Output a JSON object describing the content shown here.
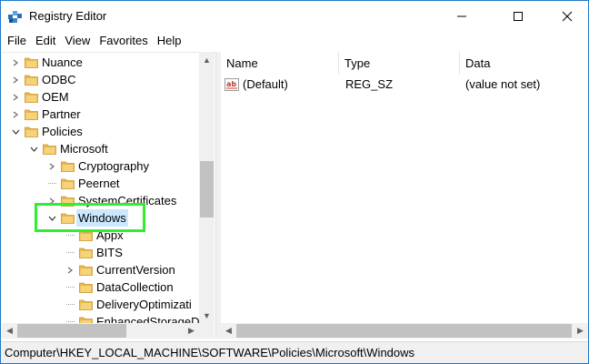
{
  "window": {
    "title": "Registry Editor",
    "icon": "registry-editor-icon"
  },
  "menu": [
    "File",
    "Edit",
    "View",
    "Favorites",
    "Help"
  ],
  "tree": {
    "items": [
      {
        "label": "Nuance",
        "expander": ">",
        "level": 0
      },
      {
        "label": "ODBC",
        "expander": ">",
        "level": 0
      },
      {
        "label": "OEM",
        "expander": ">",
        "level": 0
      },
      {
        "label": "Partner",
        "expander": ">",
        "level": 0
      },
      {
        "label": "Policies",
        "expander": "v",
        "level": 0
      },
      {
        "label": "Microsoft",
        "expander": "v",
        "level": 1
      },
      {
        "label": "Cryptography",
        "expander": ">",
        "level": 2
      },
      {
        "label": "Peernet",
        "expander": "",
        "level": 2
      },
      {
        "label": "SystemCertificates",
        "expander": ">",
        "level": 2
      },
      {
        "label": "Windows",
        "expander": "v",
        "level": 2,
        "selected": true
      },
      {
        "label": "Appx",
        "expander": "",
        "level": 3
      },
      {
        "label": "BITS",
        "expander": "",
        "level": 3
      },
      {
        "label": "CurrentVersion",
        "expander": ">",
        "level": 3
      },
      {
        "label": "DataCollection",
        "expander": "",
        "level": 3
      },
      {
        "label": "DeliveryOptimizati",
        "expander": "",
        "level": 3
      },
      {
        "label": "EnhancedStorageD",
        "expander": "",
        "level": 3
      }
    ]
  },
  "list": {
    "columns": [
      "Name",
      "Type",
      "Data"
    ],
    "rows": [
      {
        "name": "(Default)",
        "type": "REG_SZ",
        "data": "(value not set)",
        "icon": "string-value-icon"
      }
    ]
  },
  "status": {
    "path": "Computer\\HKEY_LOCAL_MACHINE\\SOFTWARE\\Policies\\Microsoft\\Windows"
  },
  "colors": {
    "highlight_box": "#2fef2f",
    "selection": "#cce8ff",
    "folder": "#e8b84a"
  }
}
